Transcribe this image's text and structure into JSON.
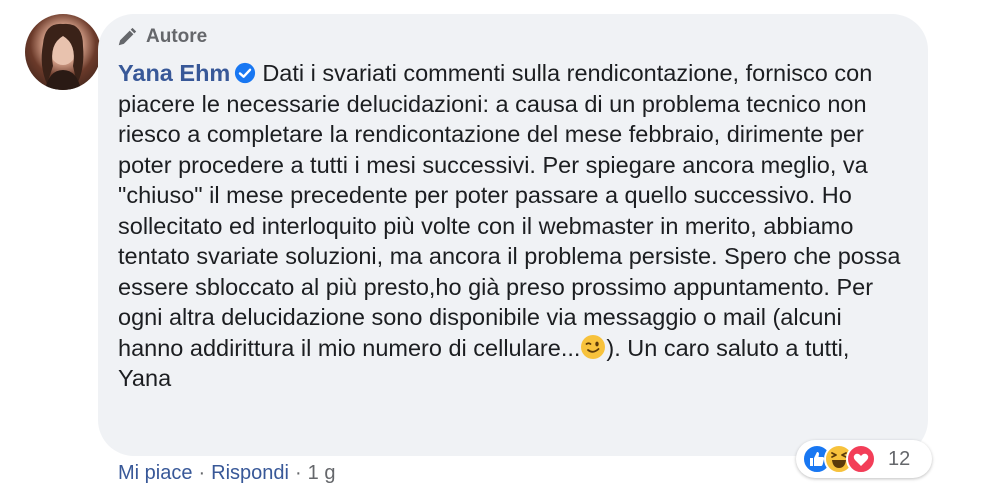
{
  "comment": {
    "badge": "Autore",
    "author": "Yana Ehm",
    "text": "Dati i svariati commenti sulla rendicontazione, fornisco con piacere le necessarie delucidazioni: a causa di un problema tecnico non riesco a completare la rendicontazione del mese febbraio, dirimente per poter procedere a tutti i mesi successivi. Per spiegare ancora meglio, va \"chiuso\" il mese precedente per poter passare a quello successivo. Ho sollecitato ed interloquito più volte con il webmaster in merito, abbiamo tentato svariate soluzioni, ma ancora il problema persiste. Spero che possa essere sbloccato al più presto,ho già preso prossimo appuntamento. Per ogni altra delucidazione sono disponibile via messaggio o mail (alcuni hanno addirittura il mio numero di cellulare...",
    "text_after_emoji": "). Un caro saluto a tutti,",
    "signature": "Yana",
    "emoji": "winking-face"
  },
  "actions": {
    "like": "Mi piace",
    "reply": "Rispondi",
    "separator": "·",
    "time": "1 g"
  },
  "reactions": {
    "types": [
      "like",
      "haha",
      "love"
    ],
    "count": "12"
  },
  "colors": {
    "link": "#385898",
    "bubble": "#f0f2f5",
    "verified": "#1877f2"
  }
}
